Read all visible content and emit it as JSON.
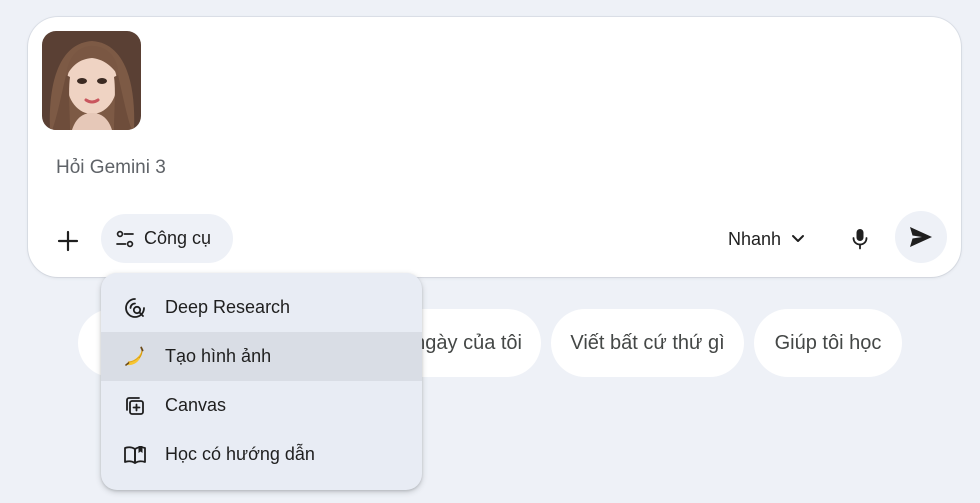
{
  "composer": {
    "placeholder": "Hỏi Gemini 3",
    "tools_label": "Công cụ",
    "mode_label": "Nhanh"
  },
  "suggestions": [
    "ngày của tôi",
    "Viết bất cứ thứ gì",
    "Giúp tôi học"
  ],
  "tools_menu": {
    "items": [
      {
        "label": "Deep Research",
        "icon": "deep-research-icon"
      },
      {
        "label": "Tạo hình ảnh",
        "icon": "banana-icon",
        "highlighted": true
      },
      {
        "label": "Canvas",
        "icon": "canvas-icon"
      },
      {
        "label": "Học có hướng dẫn",
        "icon": "guided-learning-icon"
      }
    ]
  },
  "colors": {
    "background": "#eef1f7",
    "menu_background": "#e8ecf4",
    "menu_highlight": "#d9dde5",
    "text": "#1f1f1f"
  }
}
